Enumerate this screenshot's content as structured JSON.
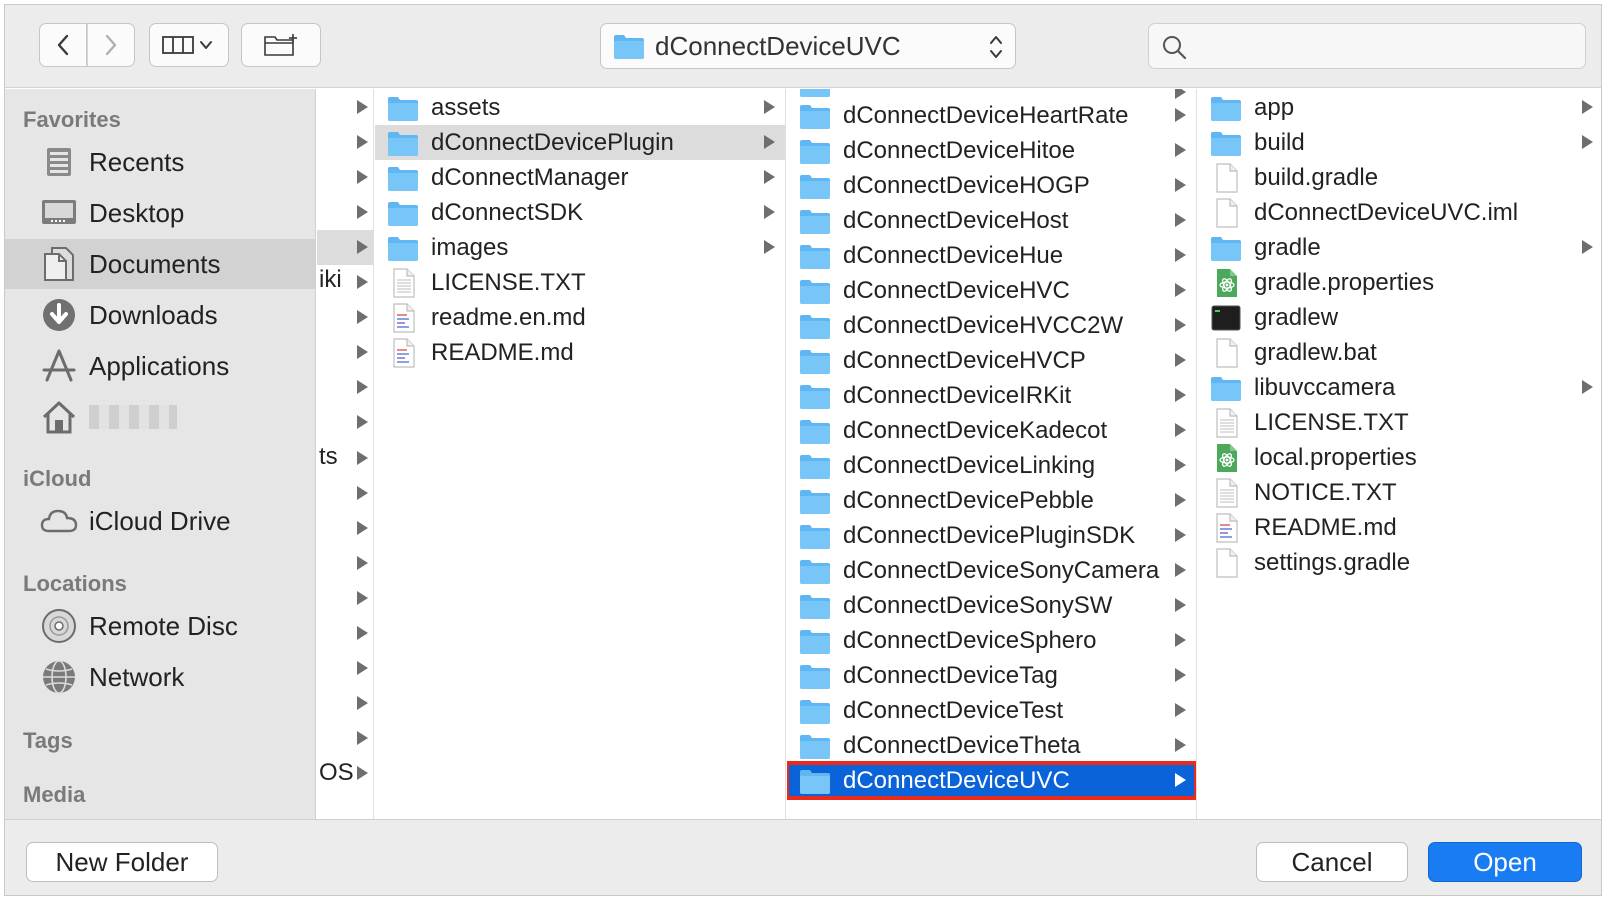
{
  "toolbar": {
    "path_label": "dConnectDeviceUVC",
    "search_placeholder": ""
  },
  "sidebar": {
    "sections": [
      {
        "label": "Favorites"
      },
      {
        "label": "iCloud"
      },
      {
        "label": "Locations"
      },
      {
        "label": "Tags"
      },
      {
        "label": "Media"
      }
    ],
    "items": [
      {
        "label": "Recents",
        "icon": "recents-icon"
      },
      {
        "label": "Desktop",
        "icon": "desktop-icon"
      },
      {
        "label": "Documents",
        "icon": "documents-icon",
        "selected": true
      },
      {
        "label": "Downloads",
        "icon": "downloads-icon"
      },
      {
        "label": "Applications",
        "icon": "applications-icon"
      },
      {
        "label": "",
        "icon": "home-icon"
      },
      {
        "label": "iCloud Drive",
        "icon": "icloud-icon"
      },
      {
        "label": "Remote Disc",
        "icon": "disc-icon"
      },
      {
        "label": "Network",
        "icon": "network-icon"
      }
    ]
  },
  "column0": {
    "fragments": [
      "iki",
      "ts",
      "OS"
    ]
  },
  "column1": {
    "items": [
      {
        "name": "assets",
        "kind": "folder"
      },
      {
        "name": "dConnectDevicePlugin",
        "kind": "folder",
        "selected": true
      },
      {
        "name": "dConnectManager",
        "kind": "folder"
      },
      {
        "name": "dConnectSDK",
        "kind": "folder"
      },
      {
        "name": "images",
        "kind": "folder"
      },
      {
        "name": "LICENSE.TXT",
        "kind": "text"
      },
      {
        "name": "readme.en.md",
        "kind": "md"
      },
      {
        "name": "README.md",
        "kind": "md"
      }
    ]
  },
  "column2": {
    "items": [
      {
        "name": "dConnectDeviceHeartRate"
      },
      {
        "name": "dConnectDeviceHitoe"
      },
      {
        "name": "dConnectDeviceHOGP"
      },
      {
        "name": "dConnectDeviceHost"
      },
      {
        "name": "dConnectDeviceHue"
      },
      {
        "name": "dConnectDeviceHVC"
      },
      {
        "name": "dConnectDeviceHVCC2W"
      },
      {
        "name": "dConnectDeviceHVCP"
      },
      {
        "name": "dConnectDeviceIRKit"
      },
      {
        "name": "dConnectDeviceKadecot"
      },
      {
        "name": "dConnectDeviceLinking"
      },
      {
        "name": "dConnectDevicePebble"
      },
      {
        "name": "dConnectDevicePluginSDK"
      },
      {
        "name": "dConnectDeviceSonyCamera"
      },
      {
        "name": "dConnectDeviceSonySW"
      },
      {
        "name": "dConnectDeviceSphero"
      },
      {
        "name": "dConnectDeviceTag"
      },
      {
        "name": "dConnectDeviceTest"
      },
      {
        "name": "dConnectDeviceTheta"
      },
      {
        "name": "dConnectDeviceUVC",
        "selected": true
      }
    ]
  },
  "column3": {
    "items": [
      {
        "name": "app",
        "kind": "folder"
      },
      {
        "name": "build",
        "kind": "folder"
      },
      {
        "name": "build.gradle",
        "kind": "file"
      },
      {
        "name": "dConnectDeviceUVC.iml",
        "kind": "file"
      },
      {
        "name": "gradle",
        "kind": "folder"
      },
      {
        "name": "gradle.properties",
        "kind": "atom"
      },
      {
        "name": "gradlew",
        "kind": "terminal"
      },
      {
        "name": "gradlew.bat",
        "kind": "file"
      },
      {
        "name": "libuvccamera",
        "kind": "folder"
      },
      {
        "name": "LICENSE.TXT",
        "kind": "text"
      },
      {
        "name": "local.properties",
        "kind": "atom"
      },
      {
        "name": "NOTICE.TXT",
        "kind": "text"
      },
      {
        "name": "README.md",
        "kind": "md"
      },
      {
        "name": "settings.gradle",
        "kind": "file"
      }
    ]
  },
  "buttons": {
    "new_folder": "New Folder",
    "cancel": "Cancel",
    "open": "Open"
  },
  "colors": {
    "accent": "#1a7cf3",
    "selection": "#0a63d9",
    "highlight_border": "#ec2a1c",
    "folder": "#5fb6f2"
  }
}
